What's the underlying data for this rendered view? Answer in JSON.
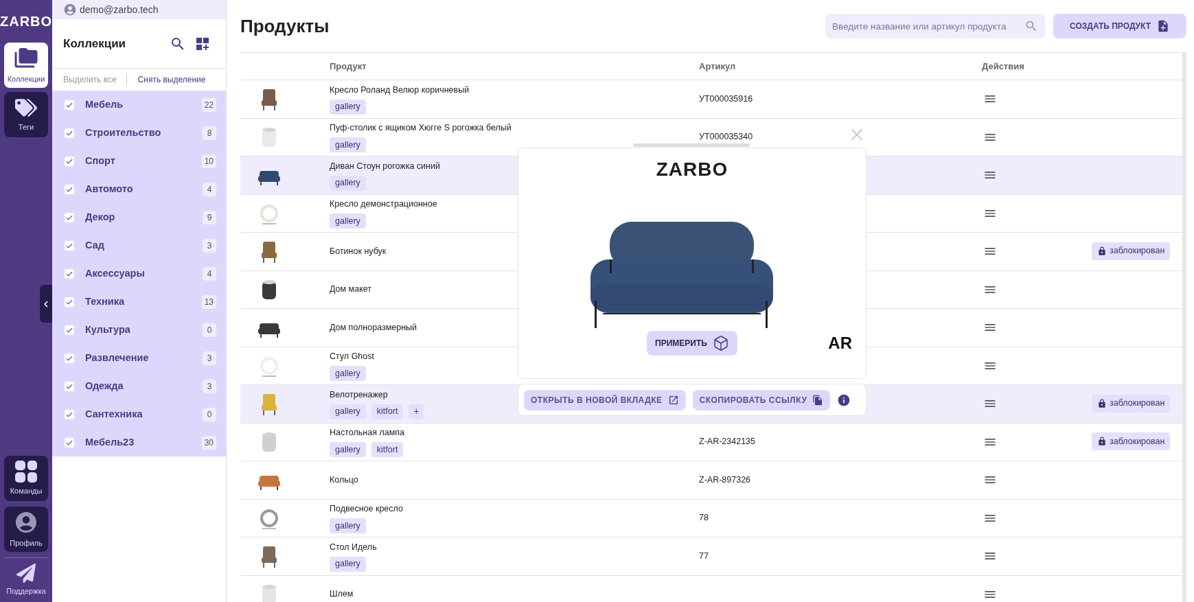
{
  "rail": {
    "logo": "ZARBO",
    "top_items": [
      {
        "label": "Коллекции",
        "kind": "collections",
        "selected": true
      },
      {
        "label": "Теги",
        "kind": "tags",
        "selected": false
      }
    ],
    "bottom_items": [
      {
        "label": "Команды",
        "kind": "teams",
        "selected": false
      },
      {
        "label": "Профиль",
        "kind": "profile",
        "selected": false
      }
    ],
    "support": "Поддержка"
  },
  "user": {
    "email": "demo@zarbo.tech"
  },
  "collections": {
    "title": "Коллекции",
    "select_all": "Выделить все",
    "deselect": "Снять выделение",
    "items": [
      {
        "name": "Мебель",
        "count": "22",
        "checked": true
      },
      {
        "name": "Строительство",
        "count": "8",
        "checked": true
      },
      {
        "name": "Спорт",
        "count": "10",
        "checked": true
      },
      {
        "name": "Автомото",
        "count": "4",
        "checked": true
      },
      {
        "name": "Декор",
        "count": "9",
        "checked": true
      },
      {
        "name": "Сад",
        "count": "3",
        "checked": true
      },
      {
        "name": "Аксессуары",
        "count": "4",
        "checked": true
      },
      {
        "name": "Техника",
        "count": "13",
        "checked": true
      },
      {
        "name": "Культура",
        "count": "0",
        "checked": true
      },
      {
        "name": "Развлечение",
        "count": "3",
        "checked": true
      },
      {
        "name": "Одежда",
        "count": "3",
        "checked": true
      },
      {
        "name": "Сантехника",
        "count": "0",
        "checked": true
      },
      {
        "name": "Мебель23",
        "count": "30",
        "checked": true
      }
    ]
  },
  "page": {
    "title": "Продукты",
    "search": {
      "placeholder": "Введите название или артикул продукта"
    },
    "create_button": "СОЗДАТЬ ПРОДУКТ"
  },
  "table": {
    "columns": [
      "Продукт",
      "Артикул",
      "Действия"
    ],
    "rows": [
      {
        "name": "Кресло Роланд Велюр коричневый",
        "tags": [
          "gallery"
        ],
        "article": "УТ000035916",
        "selected": false
      },
      {
        "name": "Пуф-столик с ящиком Хюгге S рогожка белый",
        "tags": [
          "gallery"
        ],
        "article": "УТ000035340",
        "selected": false
      },
      {
        "name": "Диван Стоун рогожка синий",
        "tags": [
          "gallery"
        ],
        "selected": true
      },
      {
        "name": "Кресло демонстрационное",
        "tags": [
          "gallery"
        ],
        "selected": false
      },
      {
        "name": "Ботинок нубук",
        "tags": [],
        "selected": false,
        "badge": "заблокирован"
      },
      {
        "name": "Дом макет",
        "tags": [],
        "selected": false
      },
      {
        "name": "Дом полноразмерный",
        "tags": [],
        "selected": false
      },
      {
        "name": "Стул Ghost",
        "tags": [
          "gallery"
        ],
        "selected": false
      },
      {
        "name": "Велотренажер",
        "tags": [
          "gallery",
          "kitfort"
        ],
        "add_tag": "+",
        "selected": true,
        "badge": "заблокирован"
      },
      {
        "name": "Настольная лампа",
        "tags": [
          "gallery",
          "kitfort"
        ],
        "article": "Z-AR-2342135",
        "selected": false,
        "badge": "заблокирован"
      },
      {
        "name": "Кольцо",
        "tags": [],
        "article": "Z-AR-897326",
        "selected": false
      },
      {
        "name": "Подвесное кресло",
        "tags": [
          "gallery"
        ],
        "article": "78",
        "selected": false
      },
      {
        "name": "Стол Идель",
        "tags": [
          "gallery"
        ],
        "article": "77",
        "selected": false
      },
      {
        "name": "Шлем",
        "tags": [],
        "selected": false
      }
    ]
  },
  "preview": {
    "logo": "ZARBO",
    "try_button": "ПРИМЕРИТЬ",
    "ar_logo": "AR",
    "open_button": "ОТКРЫТЬ В НОВОЙ ВКЛАДКЕ",
    "copy_button": "СКОПИРОВАТЬ ССЫЛКУ"
  }
}
